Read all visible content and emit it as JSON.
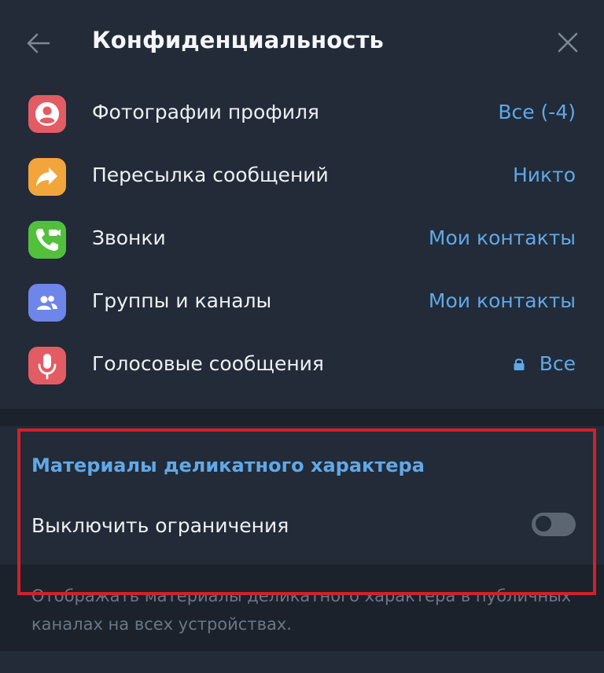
{
  "header": {
    "title": "Конфиденциальность",
    "back_icon": "arrow-left-icon",
    "close_icon": "close-icon"
  },
  "settings": [
    {
      "label": "Фотографии профиля",
      "value": "Все (-4)",
      "icon": "profile-icon",
      "icon_color": "#e35c64"
    },
    {
      "label": "Пересылка сообщений",
      "value": "Никто",
      "icon": "forward-icon",
      "icon_color": "#f2a53b"
    },
    {
      "label": "Звонки",
      "value": "Мои контакты",
      "icon": "phone-icon",
      "icon_color": "#52c03b"
    },
    {
      "label": "Группы и каналы",
      "value": "Мои контакты",
      "icon": "group-icon",
      "icon_color": "#6e86ea"
    },
    {
      "label": "Голосовые сообщения",
      "value": "Все",
      "icon": "microphone-icon",
      "icon_color": "#e35c64",
      "locked": true
    }
  ],
  "sensitive": {
    "header": "Материалы деликатного характера",
    "toggle_label": "Выключить ограничения",
    "toggle_on": false,
    "note": "Отображать материалы деликатного характера в публичных каналах на всех устройствах."
  },
  "colors": {
    "accent": "#5fa8ea",
    "background": "#222b37",
    "highlight": "#d2202a"
  }
}
